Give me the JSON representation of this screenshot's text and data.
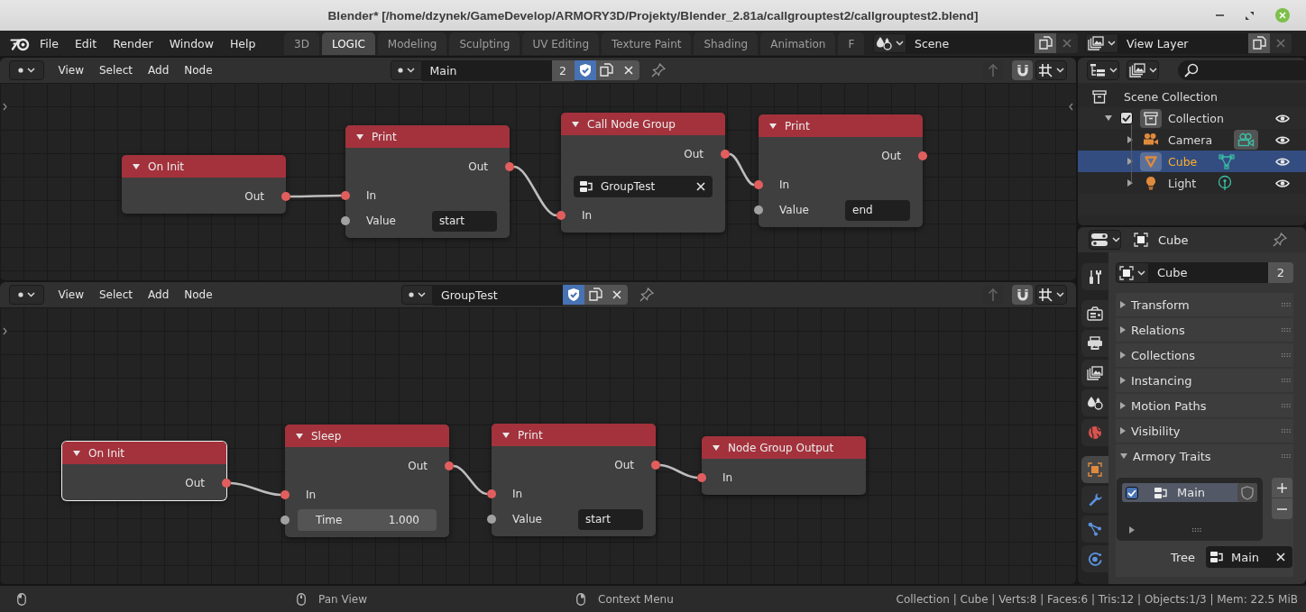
{
  "window": {
    "title": "Blender* [/home/dzynek/GameDevelop/ARMORY3D/Projekty/Blender_2.81a/callgrouptest2/callgrouptest2.blend]"
  },
  "top_bar": {
    "menus": [
      "File",
      "Edit",
      "Render",
      "Window",
      "Help"
    ],
    "workspace_tabs": [
      {
        "label": "3D",
        "selected": false
      },
      {
        "label": "LOGIC",
        "selected": true
      },
      {
        "label": "Modeling",
        "selected": false
      },
      {
        "label": "Sculpting",
        "selected": false
      },
      {
        "label": "UV Editing",
        "selected": false
      },
      {
        "label": "Texture Paint",
        "selected": false
      },
      {
        "label": "Shading",
        "selected": false
      },
      {
        "label": "Animation",
        "selected": false
      },
      {
        "label": "F",
        "selected": false
      }
    ],
    "scene": "Scene",
    "view_layer": "View Layer"
  },
  "node_editors": [
    {
      "menus": [
        "View",
        "Select",
        "Add",
        "Node"
      ],
      "node_tree": {
        "name": "Main",
        "users": "2",
        "fake_user": true
      },
      "nodes": [
        {
          "title": "On Init",
          "selected": false,
          "rows": [
            {
              "kind": "output",
              "label": "Out",
              "color": "#e25e5e"
            }
          ]
        },
        {
          "title": "Print",
          "selected": false,
          "rows": [
            {
              "kind": "output",
              "label": "Out",
              "color": "#e25e5e"
            },
            {
              "kind": "input",
              "label": "In",
              "color": "#e25e5e"
            },
            {
              "kind": "text",
              "label": "Value",
              "value": "start",
              "color": "#a1a1a1"
            }
          ]
        },
        {
          "title": "Call Node Group",
          "selected": false,
          "rows": [
            {
              "kind": "output",
              "label": "Out",
              "color": "#e25e5e"
            },
            {
              "kind": "tree",
              "value": "GroupTest"
            },
            {
              "kind": "input",
              "label": "In",
              "color": "#e25e5e"
            }
          ]
        },
        {
          "title": "Print",
          "selected": false,
          "rows": [
            {
              "kind": "output",
              "label": "Out",
              "color": "#e25e5e"
            },
            {
              "kind": "input",
              "label": "In",
              "color": "#e25e5e"
            },
            {
              "kind": "text",
              "label": "Value",
              "value": "end",
              "color": "#a1a1a1"
            }
          ]
        }
      ]
    },
    {
      "menus": [
        "View",
        "Select",
        "Add",
        "Node"
      ],
      "node_tree": {
        "name": "GroupTest",
        "fake_user": true
      },
      "nodes": [
        {
          "title": "On Init",
          "selected": true,
          "rows": [
            {
              "kind": "output",
              "label": "Out",
              "color": "#e25e5e"
            }
          ]
        },
        {
          "title": "Sleep",
          "selected": false,
          "rows": [
            {
              "kind": "output",
              "label": "Out",
              "color": "#e25e5e"
            },
            {
              "kind": "input",
              "label": "In",
              "color": "#e25e5e"
            },
            {
              "kind": "number",
              "label": "Time",
              "value": "1.000",
              "color": "#a1a1a1"
            }
          ]
        },
        {
          "title": "Print",
          "selected": false,
          "rows": [
            {
              "kind": "output",
              "label": "Out",
              "color": "#e25e5e"
            },
            {
              "kind": "input",
              "label": "In",
              "color": "#e25e5e"
            },
            {
              "kind": "text",
              "label": "Value",
              "value": "start",
              "color": "#a1a1a1"
            }
          ]
        },
        {
          "title": "Node Group Output",
          "selected": false,
          "rows": [
            {
              "kind": "input",
              "label": "In",
              "color": "#e25e5e"
            }
          ]
        }
      ]
    }
  ],
  "outliner": {
    "tree": [
      {
        "kind": "scene_collection",
        "label": "Scene Collection",
        "selected": false,
        "children": [
          {
            "kind": "collection",
            "label": "Collection",
            "selected": false,
            "expanded": true,
            "checked": true,
            "active": true,
            "visible": true,
            "children": [
              {
                "kind": "camera",
                "label": "Camera",
                "selected": false,
                "expanded": false,
                "active": false,
                "data_active": true,
                "visible": true
              },
              {
                "kind": "mesh",
                "label": "Cube",
                "selected": true,
                "expanded": false,
                "active": true,
                "data_active": false,
                "visible": true
              },
              {
                "kind": "light",
                "label": "Light",
                "selected": false,
                "expanded": false,
                "active": false,
                "data_active": false,
                "visible": true
              }
            ]
          }
        ]
      }
    ]
  },
  "properties": {
    "context": "Cube",
    "tabs": [
      {
        "kind": "tool",
        "selected": false
      },
      {
        "kind": "render",
        "selected": false
      },
      {
        "kind": "output",
        "selected": false
      },
      {
        "kind": "view_layer",
        "selected": false
      },
      {
        "kind": "scene",
        "selected": false
      },
      {
        "kind": "world",
        "selected": false
      },
      {
        "kind": "object",
        "selected": true
      },
      {
        "kind": "modifiers",
        "selected": false
      },
      {
        "kind": "particles",
        "selected": false
      },
      {
        "kind": "physics",
        "selected": false
      }
    ],
    "object_name": {
      "value": "Cube",
      "users": "2"
    },
    "panels": [
      {
        "label": "Transform",
        "expanded": false
      },
      {
        "label": "Relations",
        "expanded": false
      },
      {
        "label": "Collections",
        "expanded": false
      },
      {
        "label": "Instancing",
        "expanded": false
      },
      {
        "label": "Motion Paths",
        "expanded": false
      },
      {
        "label": "Visibility",
        "expanded": false
      },
      {
        "label": "Armory Traits",
        "expanded": true,
        "traits": {
          "items": [
            {
              "name": "Main",
              "enabled": true,
              "selected": true
            }
          ],
          "tree_label": "Tree",
          "tree": "Main"
        }
      }
    ]
  },
  "status_bar": {
    "hints": [
      {
        "kind": "left"
      },
      {
        "kind": "middle",
        "label": "Pan View"
      },
      {
        "kind": "right",
        "label": "Context Menu"
      }
    ],
    "stats": "Collection | Cube | Verts:8 | Faces:6 | Tris:12 | Objects:1/3 | Mem: 22.5 MiB"
  }
}
